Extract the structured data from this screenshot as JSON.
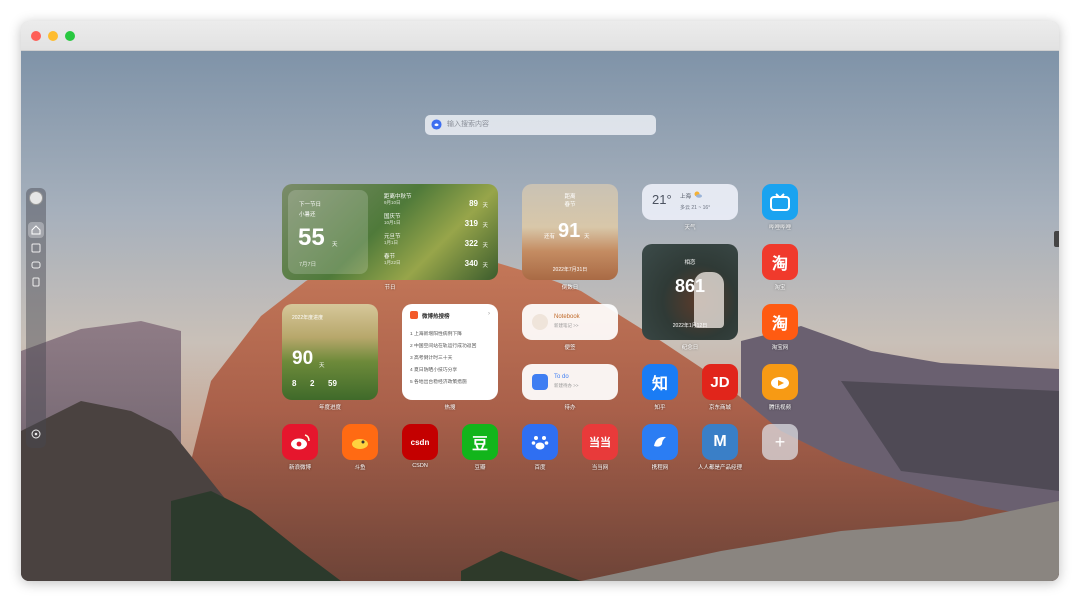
{
  "search": {
    "placeholder": "输入搜索内容"
  },
  "countdown": {
    "title": "下一节日",
    "subtitle": "小暑还",
    "days": "55",
    "unit": "天",
    "date": "7月7日",
    "items": [
      {
        "name": "距离中秋节",
        "date": "9月10日",
        "days": "89",
        "unit": "天"
      },
      {
        "name": "国庆节",
        "date": "10月1日",
        "days": "319",
        "unit": "天"
      },
      {
        "name": "元旦节",
        "date": "1月1日",
        "days": "322",
        "unit": "天"
      },
      {
        "name": "春节",
        "date": "1月22日",
        "days": "340",
        "unit": "天"
      }
    ],
    "label": "节日"
  },
  "desert": {
    "line1": "距离",
    "line2": "春节",
    "prefix": "还有",
    "days": "91",
    "unit": "天",
    "date": "2022年7月31日",
    "label": "倒数日"
  },
  "weather": {
    "temp": "21°",
    "city": "上海",
    "desc": "多云 21 ~ 16°",
    "label": "天气"
  },
  "love": {
    "title": "相恋",
    "days": "861",
    "date": "2022年1月12日",
    "label": "纪念日"
  },
  "progress": {
    "title": "2022年度进度",
    "days": "90",
    "unit": "天",
    "h": "8",
    "m": "2",
    "s": "59",
    "label": "年度进度"
  },
  "hot": {
    "title": "微博热搜榜",
    "items": [
      "1 上海新增阳性病例下降",
      "2 中国空间站在轨运行成功返回",
      "3 高考倒计时三十天",
      "4 夏日防晒小技巧分享",
      "5 各地出台稳经济政策措施"
    ],
    "label": "热搜"
  },
  "notebook": {
    "title": "Notebook",
    "sub": "新建笔记 >>",
    "label": "便签"
  },
  "todo": {
    "title": "To do",
    "sub": "新建待办 >>",
    "label": "待办"
  },
  "apps": [
    {
      "name": "哔哩哔哩",
      "glyph": "",
      "color": "#1aa3f0"
    },
    {
      "name": "淘宝",
      "glyph": "淘",
      "color": "#f03a2c"
    },
    {
      "name": "淘宝网",
      "glyph": "淘",
      "color": "#ff5b12"
    },
    {
      "name": "知乎",
      "glyph": "知",
      "color": "#1a7cf5"
    },
    {
      "name": "京东商城",
      "glyph": "JD",
      "color": "#e1251b"
    },
    {
      "name": "腾讯视频",
      "glyph": "",
      "color": "#f79a14"
    },
    {
      "name": "新浪微博",
      "glyph": "",
      "color": "#e6162d"
    },
    {
      "name": "斗鱼",
      "glyph": "",
      "color": "#ff6a13"
    },
    {
      "name": "CSDN",
      "glyph": "csdn",
      "color": "#c40000"
    },
    {
      "name": "豆瓣",
      "glyph": "豆",
      "color": "#12b51b"
    },
    {
      "name": "百度",
      "glyph": "",
      "color": "#2f6ff2"
    },
    {
      "name": "当当网",
      "glyph": "当当",
      "color": "#e83a3a"
    },
    {
      "name": "携程网",
      "glyph": "",
      "color": "#2b7df3"
    },
    {
      "name": "人人都是产品经理",
      "glyph": "M",
      "color": "#3a7fc7"
    },
    {
      "name": "",
      "glyph": "+",
      "color": "#c8c8cc"
    }
  ]
}
